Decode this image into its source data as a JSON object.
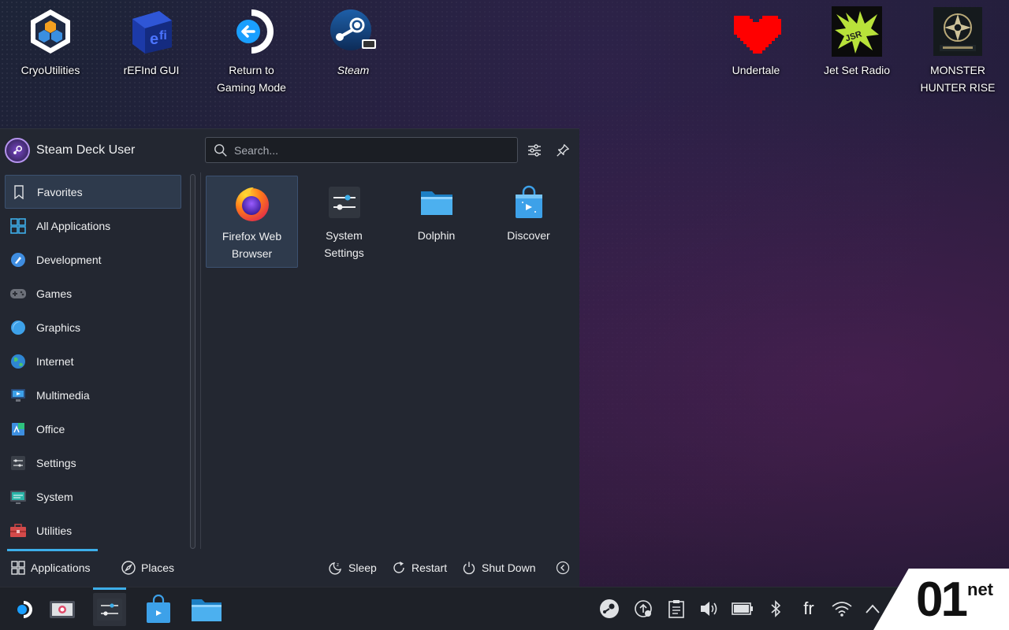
{
  "desktop": {
    "icons": [
      {
        "label": "CryoUtilities"
      },
      {
        "label": "rEFInd GUI"
      },
      {
        "label": "Return to Gaming Mode"
      },
      {
        "label": "Steam"
      },
      {
        "label": "Undertale"
      },
      {
        "label": "Jet Set Radio"
      },
      {
        "label": "MONSTER HUNTER RISE"
      }
    ]
  },
  "launcher": {
    "user_name": "Steam Deck User",
    "search_placeholder": "Search...",
    "categories": [
      {
        "label": "Favorites",
        "icon": "bookmark-icon"
      },
      {
        "label": "All Applications",
        "icon": "grid-icon"
      },
      {
        "label": "Development",
        "icon": "development-icon"
      },
      {
        "label": "Games",
        "icon": "gamepad-icon"
      },
      {
        "label": "Graphics",
        "icon": "graphics-icon"
      },
      {
        "label": "Internet",
        "icon": "globe-icon"
      },
      {
        "label": "Multimedia",
        "icon": "multimedia-icon"
      },
      {
        "label": "Office",
        "icon": "office-icon"
      },
      {
        "label": "Settings",
        "icon": "settings-icon"
      },
      {
        "label": "System",
        "icon": "system-icon"
      },
      {
        "label": "Utilities",
        "icon": "toolbox-icon"
      }
    ],
    "apps": [
      {
        "label": "Firefox Web Browser"
      },
      {
        "label": "System Settings"
      },
      {
        "label": "Dolphin"
      },
      {
        "label": "Discover"
      }
    ],
    "footer": {
      "applications": "Applications",
      "places": "Places",
      "sleep": "Sleep",
      "restart": "Restart",
      "shut_down": "Shut Down"
    }
  },
  "tray": {
    "keyboard_layout": "fr"
  },
  "brand": {
    "number": "01",
    "suffix": "net"
  },
  "colors": {
    "accent": "#3daee9",
    "panel": "#232731",
    "selection": "#2e3a4c"
  }
}
